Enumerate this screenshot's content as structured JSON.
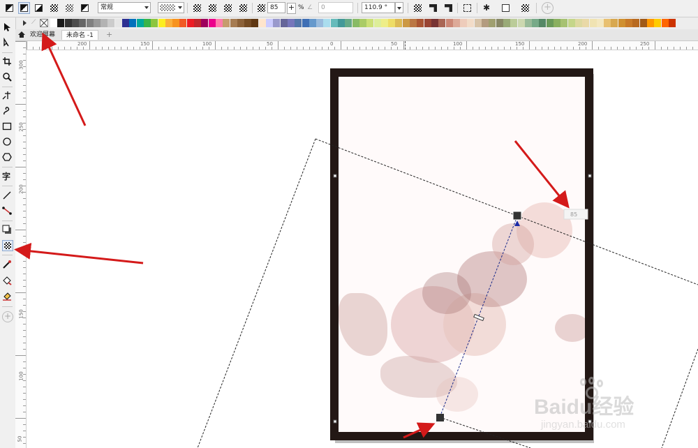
{
  "propbar": {
    "merge_mode": "常规",
    "transparency_value": "85",
    "percent_label": "%",
    "second_value": "0",
    "angle_value": "110.9 °"
  },
  "tabs": {
    "welcome": "欢迎屏幕",
    "document": "未命名 -1",
    "add": "+"
  },
  "ruler": {
    "h_ticks": [
      "200",
      "150",
      "100",
      "50",
      "0",
      "50",
      "100",
      "150",
      "200",
      "250"
    ],
    "v_ticks": [
      "300",
      "250",
      "200",
      "150",
      "100",
      "50"
    ]
  },
  "overlay": {
    "handle_value": "85"
  },
  "watermark": {
    "brand": "Baidu经验",
    "url": "jingyan.baidu.com"
  },
  "palette": [
    "#ffffff",
    "#1a1a1a",
    "#333333",
    "#4d4d4d",
    "#666666",
    "#808080",
    "#999999",
    "#b3b3b3",
    "#cccccc",
    "#e6e6e6",
    "#2e3192",
    "#0071bc",
    "#00a99d",
    "#39b54a",
    "#8cc63f",
    "#fcee21",
    "#fbb03b",
    "#f7931e",
    "#f15a24",
    "#ed1c24",
    "#c1272d",
    "#9e005d",
    "#ec008c",
    "#ff7bac",
    "#c69c6d",
    "#a67c52",
    "#8c6239",
    "#754c24",
    "#603813",
    "#ffe5cc",
    "#ccccff",
    "#9999cc",
    "#666699",
    "#7777bb",
    "#5577aa",
    "#3f6fb5",
    "#6699cc",
    "#99bbdd",
    "#aaddee",
    "#66bbbb",
    "#449999",
    "#66aa88",
    "#88bb66",
    "#aacc66",
    "#cce077",
    "#ddee99",
    "#eeee88",
    "#eedd66",
    "#ddbb55",
    "#cc9944",
    "#bb7744",
    "#aa5533",
    "#994433",
    "#773333",
    "#aa6655",
    "#cc8877",
    "#ddaa99",
    "#eeccbb",
    "#f2dcc8",
    "#d7c3a8",
    "#b39c80",
    "#a0a070",
    "#888866",
    "#99aa77",
    "#bbcc99",
    "#ccd8b0",
    "#99bb99",
    "#77aa88",
    "#558866",
    "#6a9a5a",
    "#8ab060",
    "#a7c272",
    "#c5d68a",
    "#ddd9a0",
    "#e9d9a7",
    "#f0e3b2",
    "#f4e8c0",
    "#e8c070",
    "#d8a850",
    "#d09030",
    "#c87a28",
    "#b86a20",
    "#a05a18",
    "#ff9900",
    "#ffcc00",
    "#ff6600",
    "#cc3300"
  ],
  "colors": {
    "page_border": "#231815",
    "annotation_arrow": "#d41a1a",
    "selection_tab": "#dfe8f5"
  }
}
